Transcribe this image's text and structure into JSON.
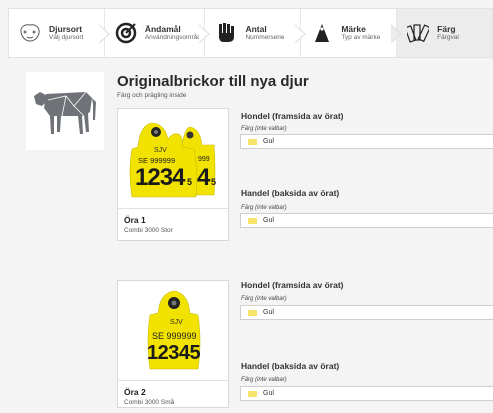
{
  "steps": [
    {
      "title": "Djursort",
      "subtitle": "Välj djursort",
      "icon": "animal-head-icon"
    },
    {
      "title": "Ändamål",
      "subtitle": "Användningsområde",
      "icon": "target-icon"
    },
    {
      "title": "Antal",
      "subtitle": "Nummerserie",
      "icon": "hand-count-icon"
    },
    {
      "title": "Märke",
      "subtitle": "Typ av märke",
      "icon": "tag-icon"
    },
    {
      "title": "Färg",
      "subtitle": "Färgval",
      "icon": "color-fan-icon"
    }
  ],
  "page": {
    "title": "Originalbrickor till nya djur",
    "subtitle": "Färg och prägling inside"
  },
  "tags": [
    {
      "name": "Öra 1",
      "desc": "Combi 3000 Stor",
      "print": {
        "brand": "SJV",
        "line1": "SE 999999",
        "digits": "1234",
        "small": "5",
        "back_line": "999",
        "back_digits": "4",
        "back_small": "5"
      },
      "sections": [
        {
          "heading": "Hondel (framsida av örat)",
          "label": "Färg (inte valbar)",
          "value": "Gul"
        },
        {
          "heading": "Handel (baksida av örat)",
          "label": "Färg (inte valbar)",
          "value": "Gul"
        }
      ]
    },
    {
      "name": "Öra 2",
      "desc": "Combi 3000 Små",
      "print": {
        "brand": "SJV",
        "line1": "SE 999999",
        "digits": "12345"
      },
      "sections": [
        {
          "heading": "Hondel (framsida av örat)",
          "label": "Färg (inte valbar)",
          "value": "Gul"
        },
        {
          "heading": "Handel (baksida av örat)",
          "label": "Färg (inte valbar)",
          "value": "Gul"
        }
      ]
    }
  ],
  "colors": {
    "tag_yellow": "#f2e200",
    "swatch_yellow": "#f7e46a",
    "cow": "#6f7378"
  }
}
